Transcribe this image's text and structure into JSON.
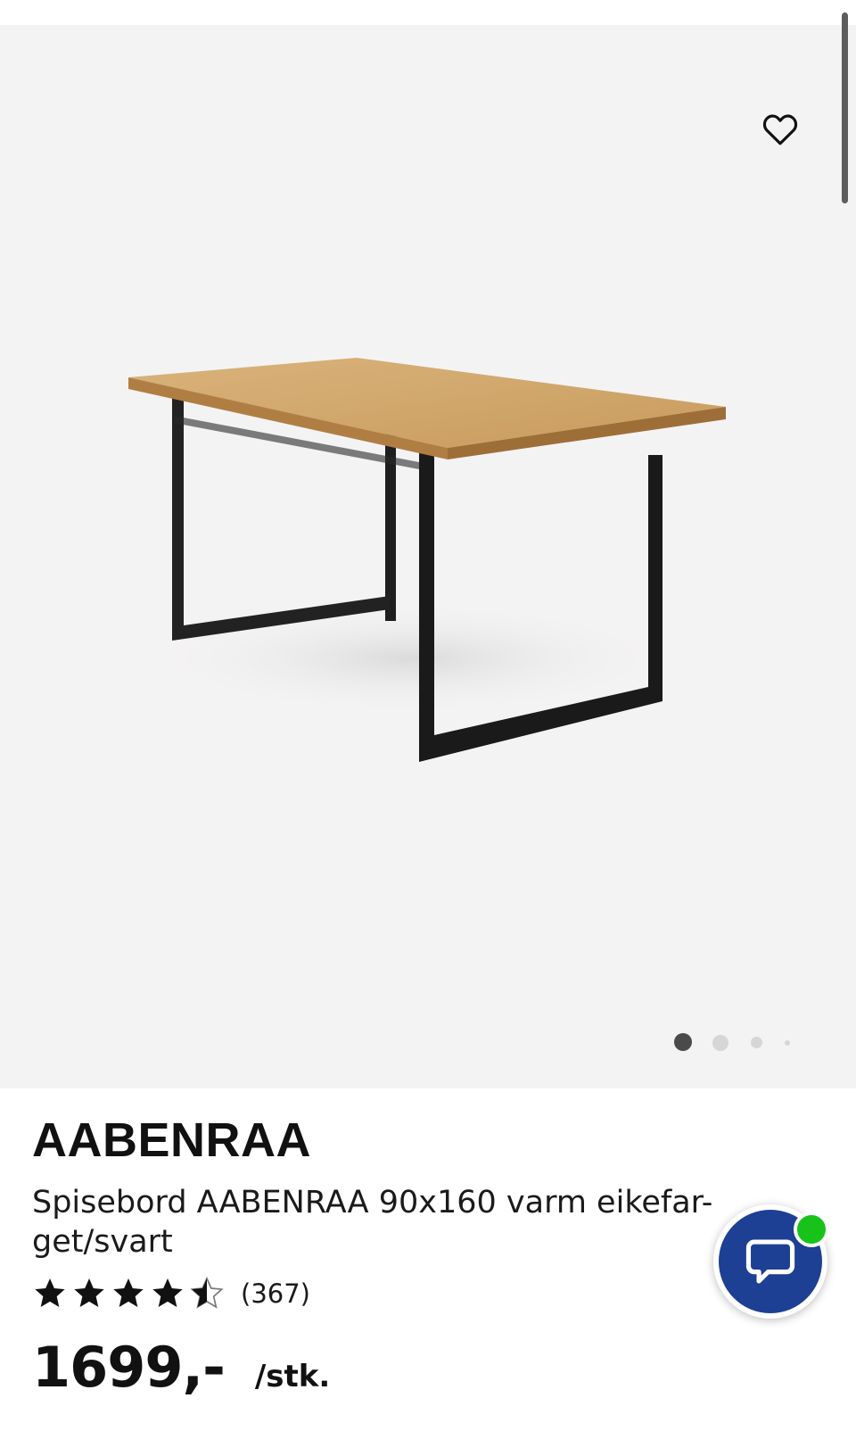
{
  "gallery": {
    "image_subject": "dining table with oak-colored top and black metal sled legs",
    "favorite_icon": "heart-outline-icon",
    "pagination": {
      "total": 4,
      "active_index": 0
    }
  },
  "product": {
    "brand": "AABENRAA",
    "name": "Spisebord AABENRAA 90x160 varm eikefar-get/svart",
    "rating": {
      "value": 4.5,
      "max": 5,
      "review_count": "(367)"
    },
    "price": "1699,-",
    "unit": "/stk."
  },
  "chat": {
    "icon": "chat-bubble-icon",
    "status_color": "#17c31b",
    "button_color": "#1d3f94"
  },
  "colors": {
    "gallery_background": "#f4f3f3",
    "text": "#111111"
  }
}
